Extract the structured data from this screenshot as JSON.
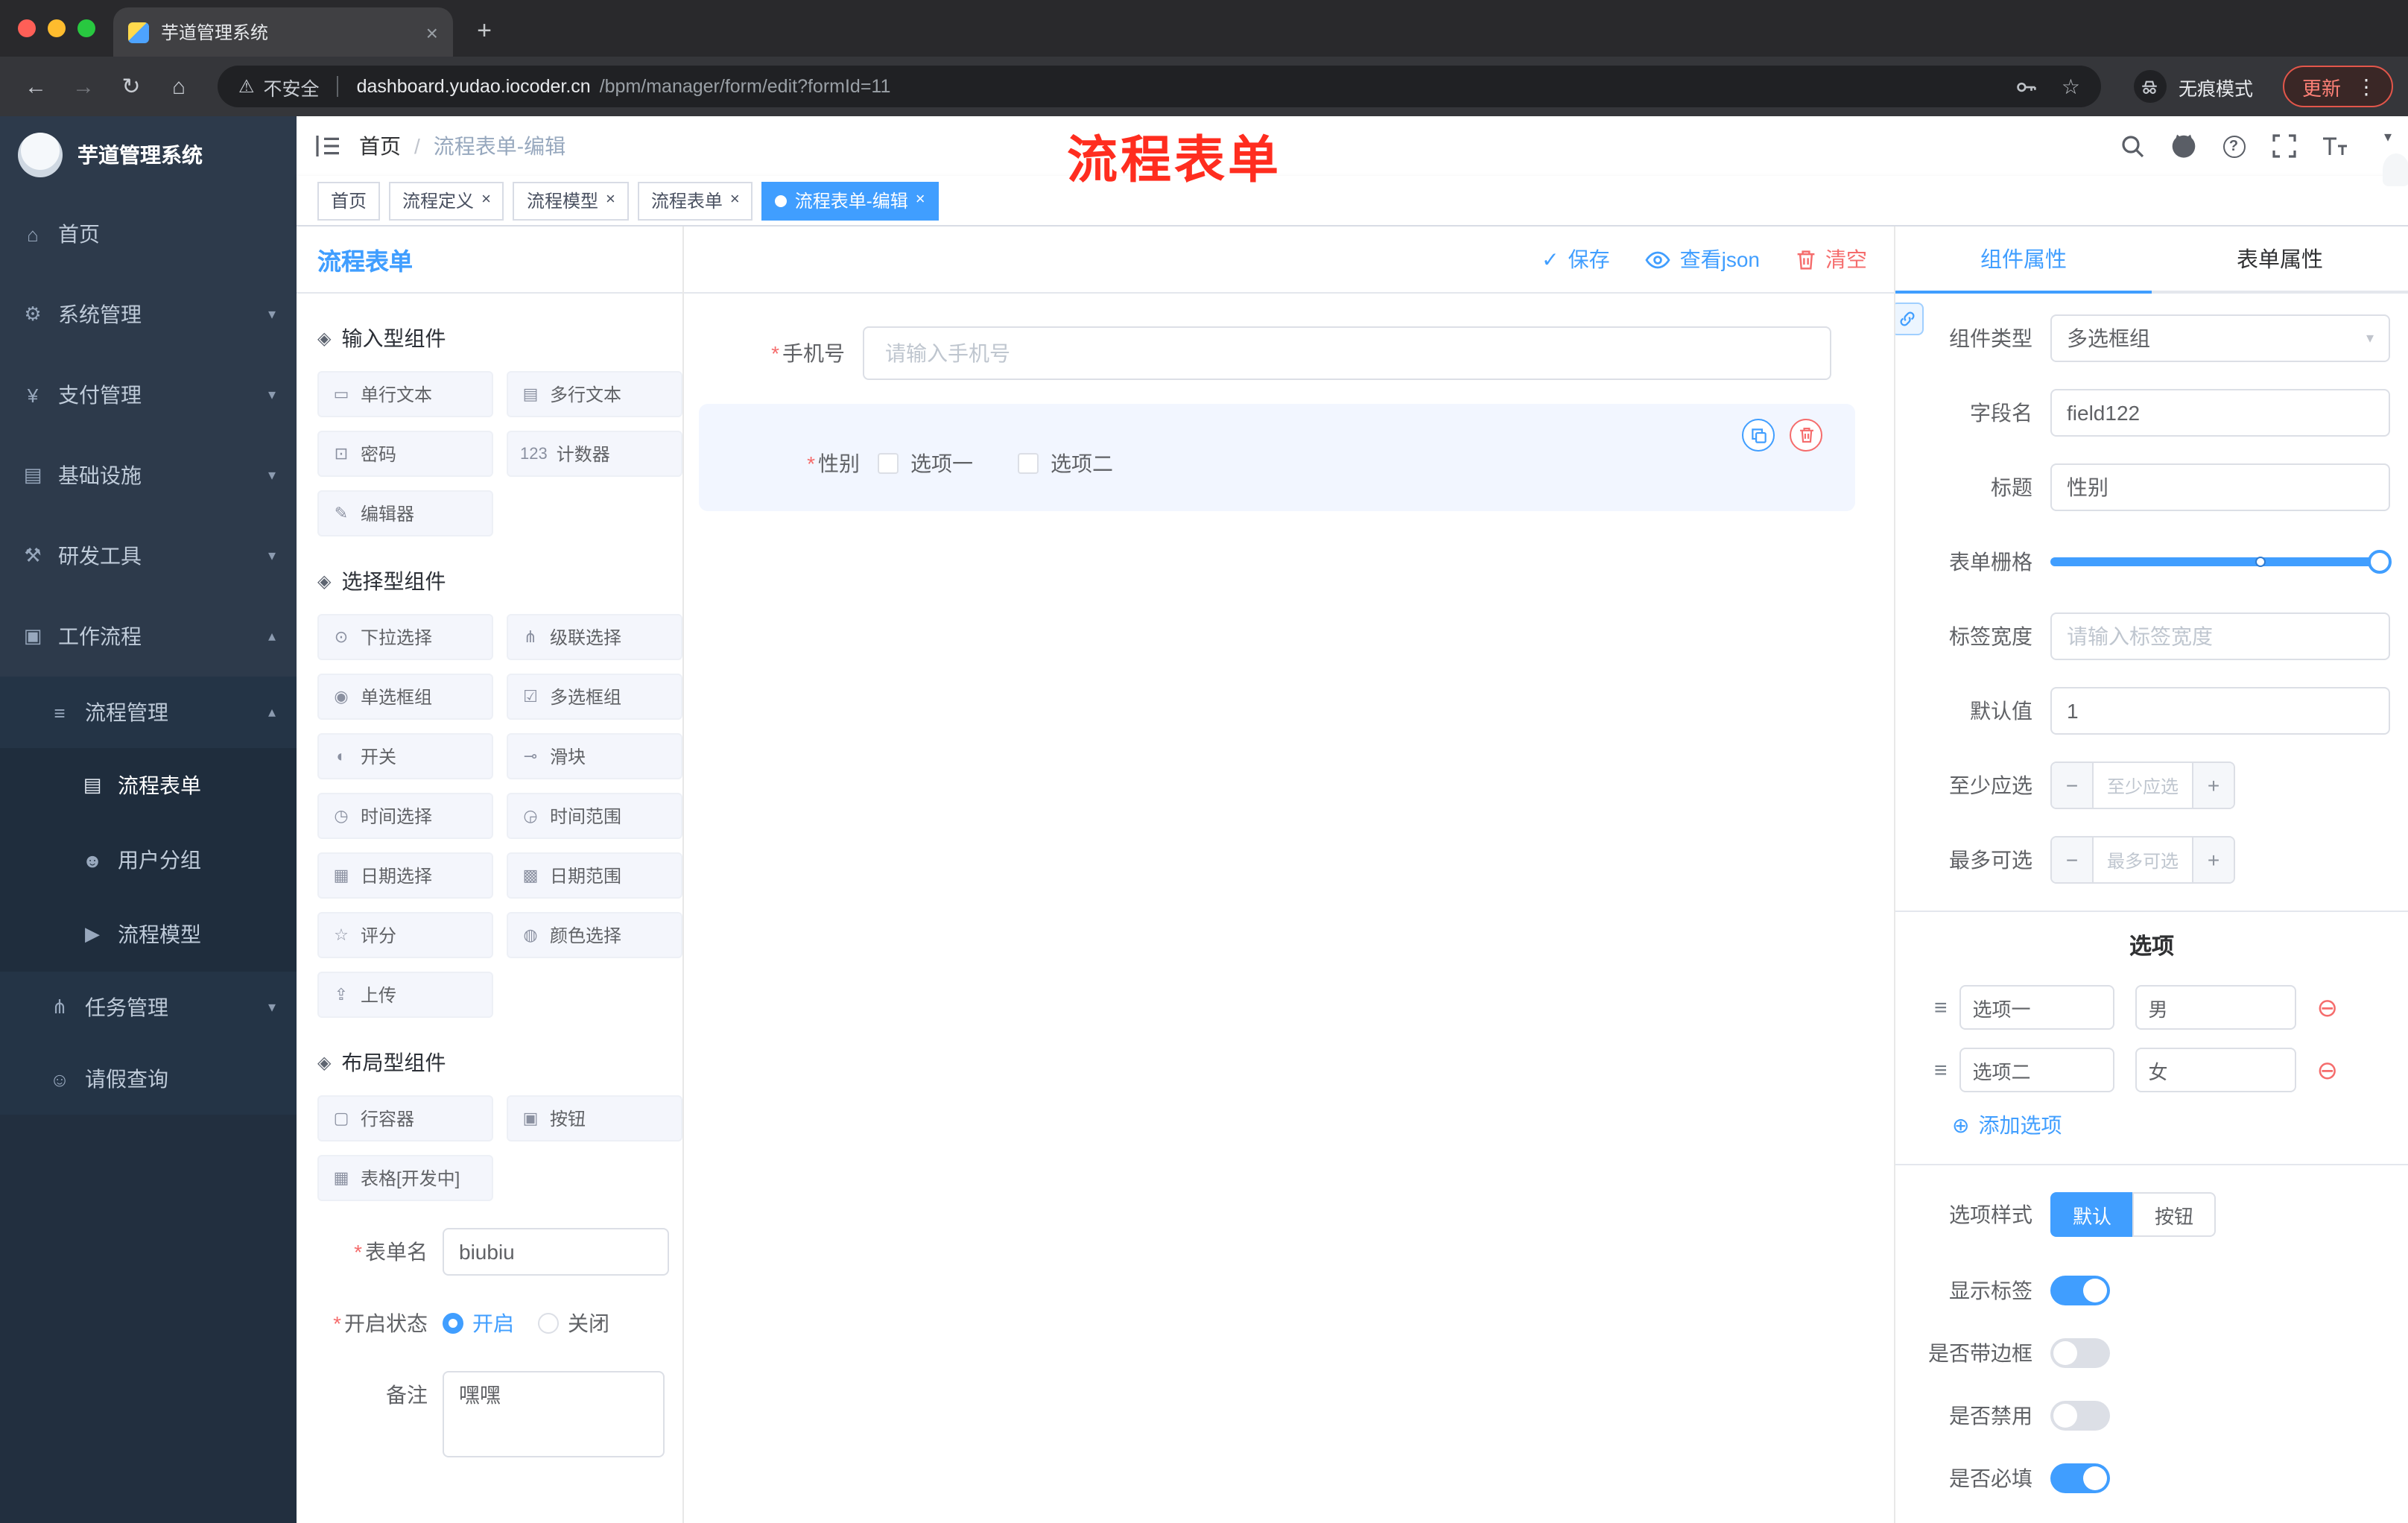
{
  "theme": {
    "accent": "#409EFF",
    "danger": "#F56C6C",
    "sidebar_bg": "#2D3A4B",
    "sidebar_sub_bg": "#1F2D3D",
    "chrome_bg": "#35363A",
    "active_tag_bg": "#409EFF",
    "overlay_red": "#FF2D1F"
  },
  "icons": {
    "close": "×",
    "new_tab": "+",
    "back": "←",
    "forward": "→",
    "reload": "↻",
    "home": "⌂",
    "warning": "⚠",
    "star": "☆",
    "more": "⋮",
    "caret_down": "▾",
    "caret_up": "▴",
    "check": "✓",
    "slash": "/",
    "remove_circle": "⊖",
    "add_circle": "⊕",
    "asterisk": "*",
    "drag_handle": "≡",
    "question": "?",
    "minus": "−",
    "plus": "+"
  },
  "browser": {
    "tab_title": "芋道管理系统",
    "security_label": "不安全",
    "url_host": "dashboard.yudao.iocoder.cn",
    "url_path": "/bpm/manager/form/edit?formId=11",
    "incognito_label": "无痕模式",
    "update_label": "更新"
  },
  "sidebar": {
    "logo_title": "芋道管理系统",
    "menu": [
      {
        "label": "首页",
        "icon": "⌂"
      },
      {
        "label": "系统管理",
        "icon": "⚙",
        "arrow": "▾"
      },
      {
        "label": "支付管理",
        "icon": "¥",
        "arrow": "▾"
      },
      {
        "label": "基础设施",
        "icon": "▤",
        "arrow": "▾"
      },
      {
        "label": "研发工具",
        "icon": "⚒",
        "arrow": "▾"
      },
      {
        "label": "工作流程",
        "icon": "▣",
        "arrow": "▴"
      },
      {
        "label": "流程管理",
        "icon": "≡",
        "arrow": "▴"
      },
      {
        "label": "流程表单",
        "icon": "▤"
      },
      {
        "label": "用户分组",
        "icon": "☻"
      },
      {
        "label": "流程模型",
        "icon": "▶"
      },
      {
        "label": "任务管理",
        "icon": "⋔",
        "arrow": "▾"
      },
      {
        "label": "请假查询",
        "icon": "☺"
      }
    ]
  },
  "header": {
    "breadcrumb_home": "首页",
    "breadcrumb_current": "流程表单-编辑",
    "overlay_title": "流程表单"
  },
  "tags": [
    {
      "label": "首页"
    },
    {
      "label": "流程定义"
    },
    {
      "label": "流程模型"
    },
    {
      "label": "流程表单"
    },
    {
      "label": "流程表单-编辑"
    }
  ],
  "designer": {
    "panel_title": "流程表单",
    "toolbar": {
      "save": "保存",
      "view_json": "查看json",
      "clear": "清空"
    },
    "groups": [
      {
        "title": "输入型组件",
        "icon": "◈",
        "items": [
          {
            "label": "单行文本",
            "icon": "▭"
          },
          {
            "label": "多行文本",
            "icon": "▤"
          },
          {
            "label": "密码",
            "icon": "⊡"
          },
          {
            "label": "计数器",
            "icon": "123"
          },
          {
            "label": "编辑器",
            "icon": "✎"
          }
        ]
      },
      {
        "title": "选择型组件",
        "icon": "◈",
        "items": [
          {
            "label": "下拉选择",
            "icon": "⊙"
          },
          {
            "label": "级联选择",
            "icon": "⋔"
          },
          {
            "label": "单选框组",
            "icon": "◉"
          },
          {
            "label": "多选框组",
            "icon": "☑"
          },
          {
            "label": "开关",
            "icon": "◐"
          },
          {
            "label": "滑块",
            "icon": "⊸"
          },
          {
            "label": "时间选择",
            "icon": "◷"
          },
          {
            "label": "时间范围",
            "icon": "◶"
          },
          {
            "label": "日期选择",
            "icon": "▦"
          },
          {
            "label": "日期范围",
            "icon": "▩"
          },
          {
            "label": "评分",
            "icon": "☆"
          },
          {
            "label": "颜色选择",
            "icon": "◍"
          },
          {
            "label": "上传",
            "icon": "⇪"
          }
        ]
      },
      {
        "title": "布局型组件",
        "icon": "◈",
        "items": [
          {
            "label": "行容器",
            "icon": "▢"
          },
          {
            "label": "按钮",
            "icon": "▣"
          },
          {
            "label": "表格[开发中]",
            "icon": "▦"
          }
        ]
      }
    ],
    "meta": {
      "name_label": "表单名",
      "name_value": "biubiu",
      "status_label": "开启状态",
      "status_on": "开启",
      "status_off": "关闭",
      "remark_label": "备注",
      "remark_value": "嘿嘿"
    },
    "canvas": {
      "phone_label": "手机号",
      "phone_placeholder": "请输入手机号",
      "gender_label": "性别",
      "gender_opt1": "选项一",
      "gender_opt2": "选项二"
    }
  },
  "props": {
    "tab_component": "组件属性",
    "tab_form": "表单属性",
    "fields": {
      "type_label": "组件类型",
      "type_value": "多选框组",
      "name_label": "字段名",
      "name_value": "field122",
      "title_label": "标题",
      "title_value": "性别",
      "grid_label": "表单栅格",
      "labelwidth_label": "标签宽度",
      "labelwidth_placeholder": "请输入标签宽度",
      "default_label": "默认值",
      "default_value": "1",
      "min_label": "至少应选",
      "min_placeholder": "至少应选",
      "max_label": "最多可选",
      "max_placeholder": "最多可选"
    },
    "options": {
      "section_title": "选项",
      "rows": [
        {
          "label": "选项一",
          "value": "男"
        },
        {
          "label": "选项二",
          "value": "女"
        }
      ],
      "add_label": "添加选项"
    },
    "style": {
      "style_label": "选项样式",
      "style_default": "默认",
      "style_button": "按钮",
      "show_label": "显示标签",
      "border_label": "是否带边框",
      "disabled_label": "是否禁用",
      "required_label": "是否必填"
    }
  }
}
